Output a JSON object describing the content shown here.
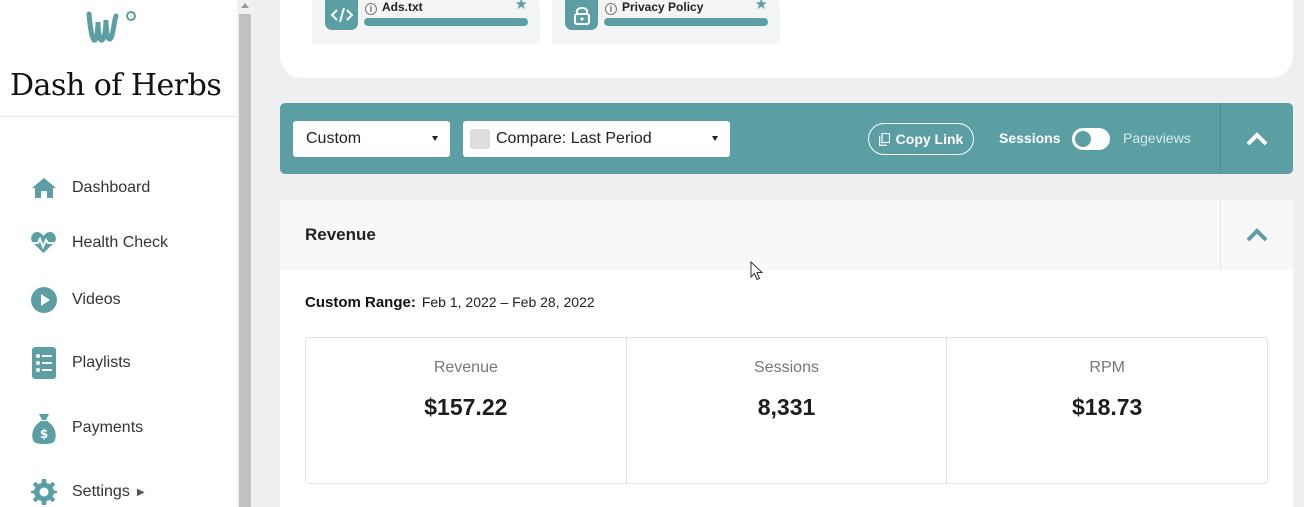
{
  "sidebar": {
    "site_name": "Dash of Herbs",
    "logo_icon": "herb-leaf-logo",
    "items": [
      {
        "label": "Dashboard",
        "icon": "home-icon"
      },
      {
        "label": "Health Check",
        "icon": "heartbeat-icon"
      },
      {
        "label": "Videos",
        "icon": "play-icon"
      },
      {
        "label": "Playlists",
        "icon": "checklist-icon"
      },
      {
        "label": "Payments",
        "icon": "money-bag-icon"
      },
      {
        "label": "Settings",
        "icon": "gear-icon",
        "has_submenu": true
      }
    ]
  },
  "top_card": {
    "files": [
      {
        "label": "Ads.txt",
        "icon": "code-icon",
        "starred": true
      },
      {
        "label": "Privacy Policy",
        "icon": "lock-icon",
        "starred": true
      }
    ]
  },
  "filters": {
    "date_range": "Custom",
    "compare": "Compare: Last Period",
    "copy_link": "Copy Link",
    "toggle_left": "Sessions",
    "toggle_right": "Pageviews"
  },
  "revenue": {
    "title": "Revenue",
    "range_label": "Custom Range:",
    "range_value": "Feb 1, 2022 – Feb 28, 2022",
    "stats": [
      {
        "label": "Revenue",
        "value": "$157.22"
      },
      {
        "label": "Sessions",
        "value": "8,331"
      },
      {
        "label": "RPM",
        "value": "$18.73"
      }
    ]
  },
  "colors": {
    "accent": "#5b9fa4",
    "background": "#efefef",
    "card": "#ffffff"
  }
}
